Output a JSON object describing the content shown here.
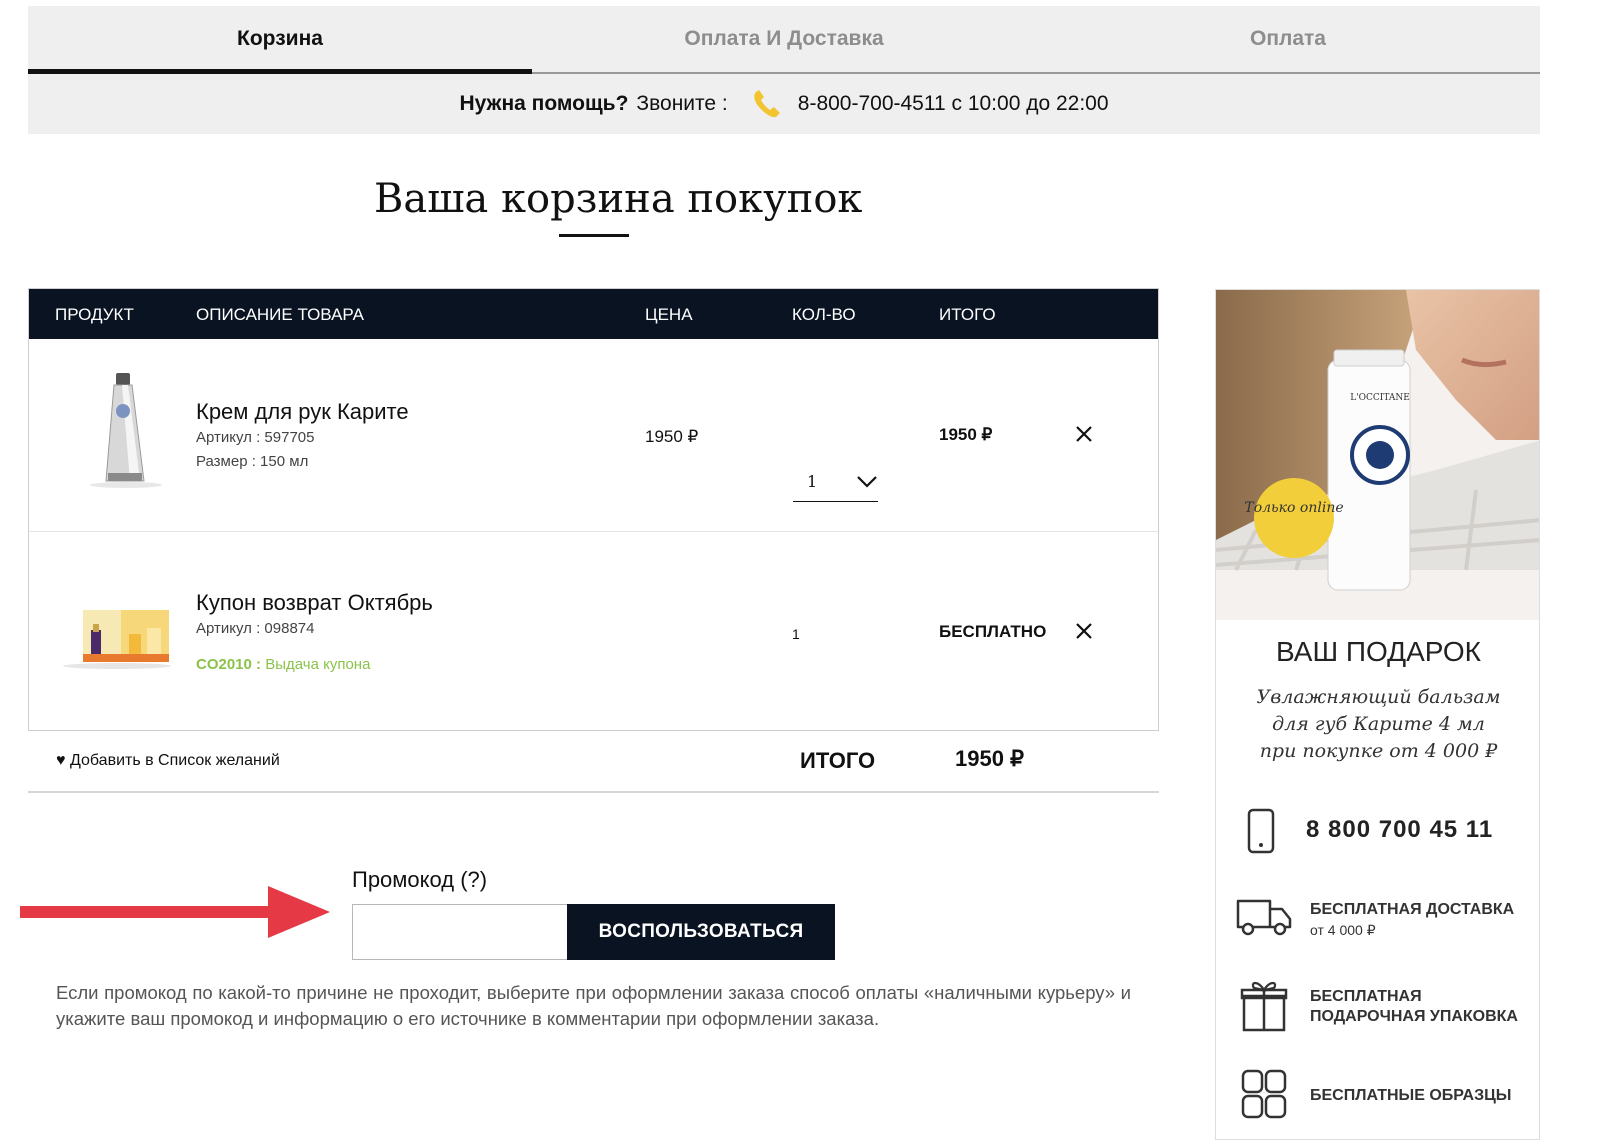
{
  "steps": [
    {
      "label": "Корзина",
      "active": true
    },
    {
      "label": "Оплата И Доставка",
      "active": false
    },
    {
      "label": "Оплата",
      "active": false
    }
  ],
  "help": {
    "question": "Нужна помощь?",
    "call": "Звоните :",
    "phone_hours": "8-800-700-4511 с 10:00 до 22:00"
  },
  "page_title": "Ваша корзина покупок",
  "table": {
    "headers": [
      "ПРОДУКТ",
      "ОПИСАНИЕ ТОВАРА",
      "ЦЕНА",
      "КОЛ-ВО",
      "ИТОГО"
    ],
    "rows": [
      {
        "name": "Крем для рук Карите",
        "article": "Артикул : 597705",
        "size": "Размер : 150 мл",
        "price": "1950 ₽",
        "qty": "1",
        "total": "1950 ₽"
      },
      {
        "name": "Купон возврат Октябрь",
        "article": "Артикул : 098874",
        "promo_code": "CO2010 :",
        "promo_text": "Выдача купона",
        "qty": "1",
        "total": "БЕСПЛАТНО"
      }
    ]
  },
  "summary": {
    "wishlist": "Добавить в Список желаний",
    "total_label": "ИТОГО",
    "total_value": "1950 ₽"
  },
  "promo": {
    "label": "Промокод (?)",
    "input_value": "",
    "button": "ВОСПОЛЬЗОВАТЬСЯ",
    "hint": "Если промокод по какой-то причине не проходит, выберите при оформлении заказа способ оплаты «наличными курьеру» и укажите ваш промокод и информацию о его источнике в комментарии при оформлении заказа."
  },
  "sidebar": {
    "badge": "Только online",
    "tube_brand": "L'OCCITANE",
    "gift_title": "ВАШ ПОДАРОК",
    "gift_desc_lines": [
      "Увлажняющий бальзам",
      "для губ Карите 4 мл",
      "при покупке от 4 000 ₽"
    ],
    "phone": "8 800 700 45 11",
    "features": [
      {
        "title": "БЕСПЛАТНАЯ ДОСТАВКА",
        "sub": "от 4 000 ₽"
      },
      {
        "title": "БЕСПЛАТНАЯ",
        "title2": "ПОДАРОЧНАЯ УПАКОВКА"
      },
      {
        "title": "БЕСПЛАТНЫЕ ОБРАЗЦЫ"
      }
    ]
  },
  "colors": {
    "dark_header": "#0a1322",
    "promo_green": "#8bc34a",
    "arrow_red": "#e53945"
  }
}
